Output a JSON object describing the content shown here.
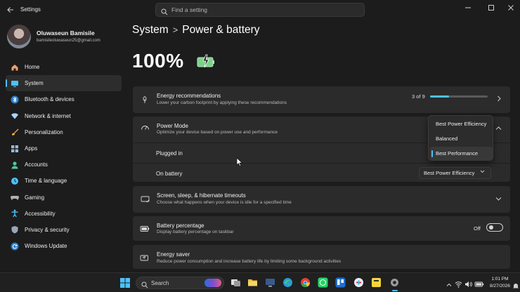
{
  "window": {
    "title": "Settings",
    "search_placeholder": "Find a setting",
    "controls": [
      "minimize-icon",
      "maximize-icon",
      "close-icon"
    ]
  },
  "profile": {
    "name": "Oluwaseun Bamisile",
    "email": "bamisileoluwaseun25@gmail.com"
  },
  "sidebar": {
    "items": [
      {
        "label": "Home",
        "icon": "home-icon",
        "color": "#f0a070"
      },
      {
        "label": "System",
        "icon": "monitor-icon",
        "color": "#4cc2ff",
        "active": true
      },
      {
        "label": "Bluetooth & devices",
        "icon": "bluetooth-icon",
        "color": "#4cc2ff"
      },
      {
        "label": "Network & internet",
        "icon": "wifi-icon",
        "color": "#a8d4ff"
      },
      {
        "label": "Personalization",
        "icon": "brush-icon",
        "color": "#e89a5a"
      },
      {
        "label": "Apps",
        "icon": "apps-icon",
        "color": "#9bb8d8"
      },
      {
        "label": "Accounts",
        "icon": "person-icon",
        "color": "#4fc7a0"
      },
      {
        "label": "Time & language",
        "icon": "globe-clock-icon",
        "color": "#4cc2ff"
      },
      {
        "label": "Gaming",
        "icon": "controller-icon",
        "color": "#b0b0b0"
      },
      {
        "label": "Accessibility",
        "icon": "accessibility-icon",
        "color": "#4cc2ff"
      },
      {
        "label": "Privacy & security",
        "icon": "shield-icon",
        "color": "#9aa6b8"
      },
      {
        "label": "Windows Update",
        "icon": "update-icon",
        "color": "#4cc2ff"
      }
    ]
  },
  "header": {
    "breadcrumb_parent": "System",
    "breadcrumb_separator": ">",
    "breadcrumb_current": "Power & battery",
    "battery_percent": "100%"
  },
  "energy_recommendations": {
    "title": "Energy recommendations",
    "subtitle": "Lower your carbon footprint by applying these recommendations",
    "progress_text": "3 of 9",
    "progress_fraction": 0.333
  },
  "power_mode": {
    "title": "Power Mode",
    "subtitle": "Optimize your device based on power use and performance",
    "plugged_in_label": "Plugged in",
    "on_battery_label": "On battery",
    "on_battery_value": "Best Power Efficiency",
    "options": [
      "Best Power Efficiency",
      "Balanced",
      "Best Performance"
    ],
    "selected_option": "Best Performance"
  },
  "screen_sleep": {
    "title": "Screen, sleep, & hibernate timeouts",
    "subtitle": "Choose what happens when your device is idle for a specified time"
  },
  "battery_percentage": {
    "title": "Battery percentage",
    "subtitle": "Display battery percentage on taskbar",
    "toggle_state": "Off"
  },
  "energy_saver": {
    "title": "Energy saver",
    "subtitle": "Reduce power consumption and increase battery life by limiting some background activities"
  },
  "taskbar": {
    "search_label": "Search",
    "time": "1:01 PM",
    "date": "8/27/2026",
    "apps": [
      {
        "name": "file-explorer-icon",
        "color": "#f2c037"
      },
      {
        "name": "edge-icon",
        "color": "#2b9ad8"
      },
      {
        "name": "chrome-icon",
        "color": "#e34133"
      },
      {
        "name": "whatsapp-icon",
        "color": "#25d366"
      },
      {
        "name": "trello-icon",
        "color": "#1f6fd1"
      },
      {
        "name": "slack-icon",
        "color": "#d8d8d8"
      },
      {
        "name": "sticky-notes-icon",
        "color": "#f5d53a"
      },
      {
        "name": "settings-icon",
        "color": "#9a9a9a"
      }
    ]
  }
}
